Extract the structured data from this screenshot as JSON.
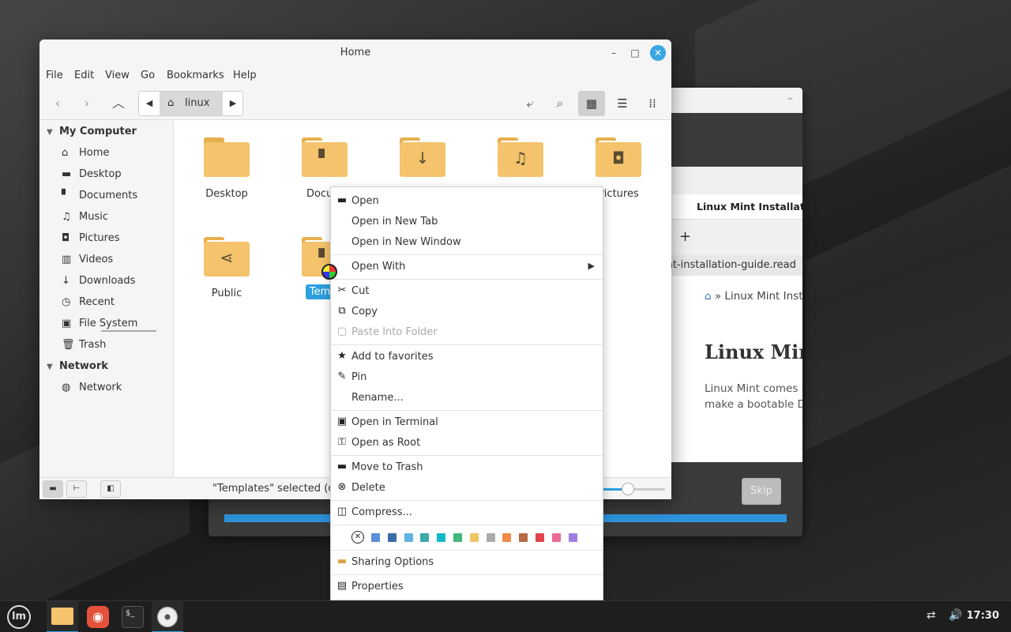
{
  "file_manager": {
    "title": "Home",
    "menus": [
      "File",
      "Edit",
      "View",
      "Go",
      "Bookmarks",
      "Help"
    ],
    "path": {
      "crumb": "linux"
    },
    "sidebar": {
      "sections": [
        {
          "title": "My Computer",
          "items": [
            {
              "label": "Home",
              "icon": "home-icon"
            },
            {
              "label": "Desktop",
              "icon": "desktop-icon"
            },
            {
              "label": "Documents",
              "icon": "document-icon"
            },
            {
              "label": "Music",
              "icon": "music-icon"
            },
            {
              "label": "Pictures",
              "icon": "camera-icon"
            },
            {
              "label": "Videos",
              "icon": "film-icon"
            },
            {
              "label": "Downloads",
              "icon": "download-icon"
            },
            {
              "label": "Recent",
              "icon": "clock-icon"
            },
            {
              "label": "File System",
              "icon": "drive-icon"
            },
            {
              "label": "Trash",
              "icon": "trash-icon"
            }
          ]
        },
        {
          "title": "Network",
          "items": [
            {
              "label": "Network",
              "icon": "globe-icon"
            }
          ]
        }
      ]
    },
    "files": [
      {
        "label": "Desktop",
        "icon": "folder-icon"
      },
      {
        "label": "Docum",
        "icon": "folder-document-icon"
      },
      {
        "label": "",
        "icon": "folder-download-icon"
      },
      {
        "label": "",
        "icon": "folder-music-icon"
      },
      {
        "label": "Pictures",
        "icon": "folder-camera-icon"
      },
      {
        "label": "Public",
        "icon": "folder-share-icon"
      },
      {
        "label": "Templ",
        "icon": "folder-template-icon",
        "selected": true
      }
    ],
    "status": "\"Templates\" selected (con",
    "zoom_level": 0.4
  },
  "context_menu": {
    "items": [
      {
        "label": "Open",
        "icon": "folder-open-icon"
      },
      {
        "label": "Open in New Tab",
        "icon": ""
      },
      {
        "label": "Open in New Window",
        "icon": ""
      },
      {
        "label": "Open With",
        "icon": "",
        "submenu": true
      },
      {
        "label": "Cut",
        "icon": "scissors-icon"
      },
      {
        "label": "Copy",
        "icon": "copy-icon"
      },
      {
        "label": "Paste Into Folder",
        "icon": "clipboard-icon",
        "disabled": true
      },
      {
        "label": "Add to favorites",
        "icon": "star-icon"
      },
      {
        "label": "Pin",
        "icon": "pin-icon"
      },
      {
        "label": "Rename...",
        "icon": ""
      },
      {
        "label": "Open in Terminal",
        "icon": "terminal-icon"
      },
      {
        "label": "Open as Root",
        "icon": "key-icon"
      },
      {
        "label": "Move to Trash",
        "icon": "trash-icon"
      },
      {
        "label": "Delete",
        "icon": "delete-icon"
      },
      {
        "label": "Compress...",
        "icon": "archive-icon"
      },
      {
        "label": "Sharing Options",
        "icon": "share-folder-icon"
      },
      {
        "label": "Properties",
        "icon": "properties-icon"
      }
    ],
    "emblem_colors": [
      "#5b8fd8",
      "#3d6aa8",
      "#5fb4e4",
      "#3fa9a9",
      "#14b8c8",
      "#3fb87a",
      "#f1c467",
      "#aaaaaa",
      "#ee8a4a",
      "#b66a44",
      "#e0444c",
      "#ec6b96",
      "#9e7ede"
    ]
  },
  "installer": {
    "tab_title": "Linux Mint Installatio",
    "url": "int-installation-guide.read",
    "breadcrumb": "» Linux Mint Inst",
    "heading": "Linux Min",
    "paragraph_line1": "Linux Mint comes i",
    "paragraph_line2": "make a bootable DV",
    "skip_label": "Skip"
  },
  "taskbar": {
    "apps": [
      "mint-menu-icon",
      "files-icon",
      "firefox-icon",
      "terminal-icon",
      "disc-icon"
    ],
    "clock": "17:30"
  }
}
